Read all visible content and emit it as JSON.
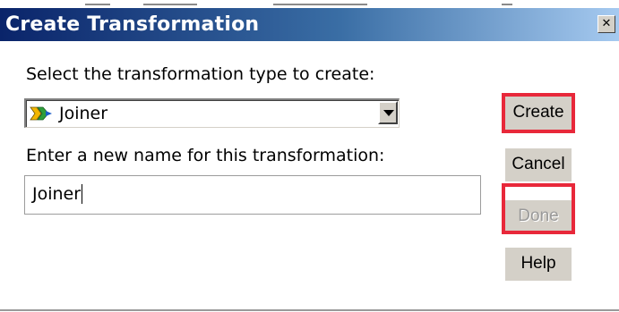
{
  "dialog": {
    "title": "Create Transformation",
    "close_symbol": "✕"
  },
  "form": {
    "type_label": "Select the transformation type to create:",
    "type_selected": "Joiner",
    "type_icon": "joiner-icon",
    "name_label": "Enter a new name for this transformation:",
    "name_value": "Joiner"
  },
  "buttons": {
    "create": "Create",
    "cancel": "Cancel",
    "done": "Done",
    "help": "Help"
  },
  "colors": {
    "titlebar_start": "#0a246a",
    "titlebar_end": "#a6caf0",
    "button_face": "#d4d0c8",
    "highlight_red": "#e8283a",
    "disabled_text": "#9a9a9a"
  }
}
